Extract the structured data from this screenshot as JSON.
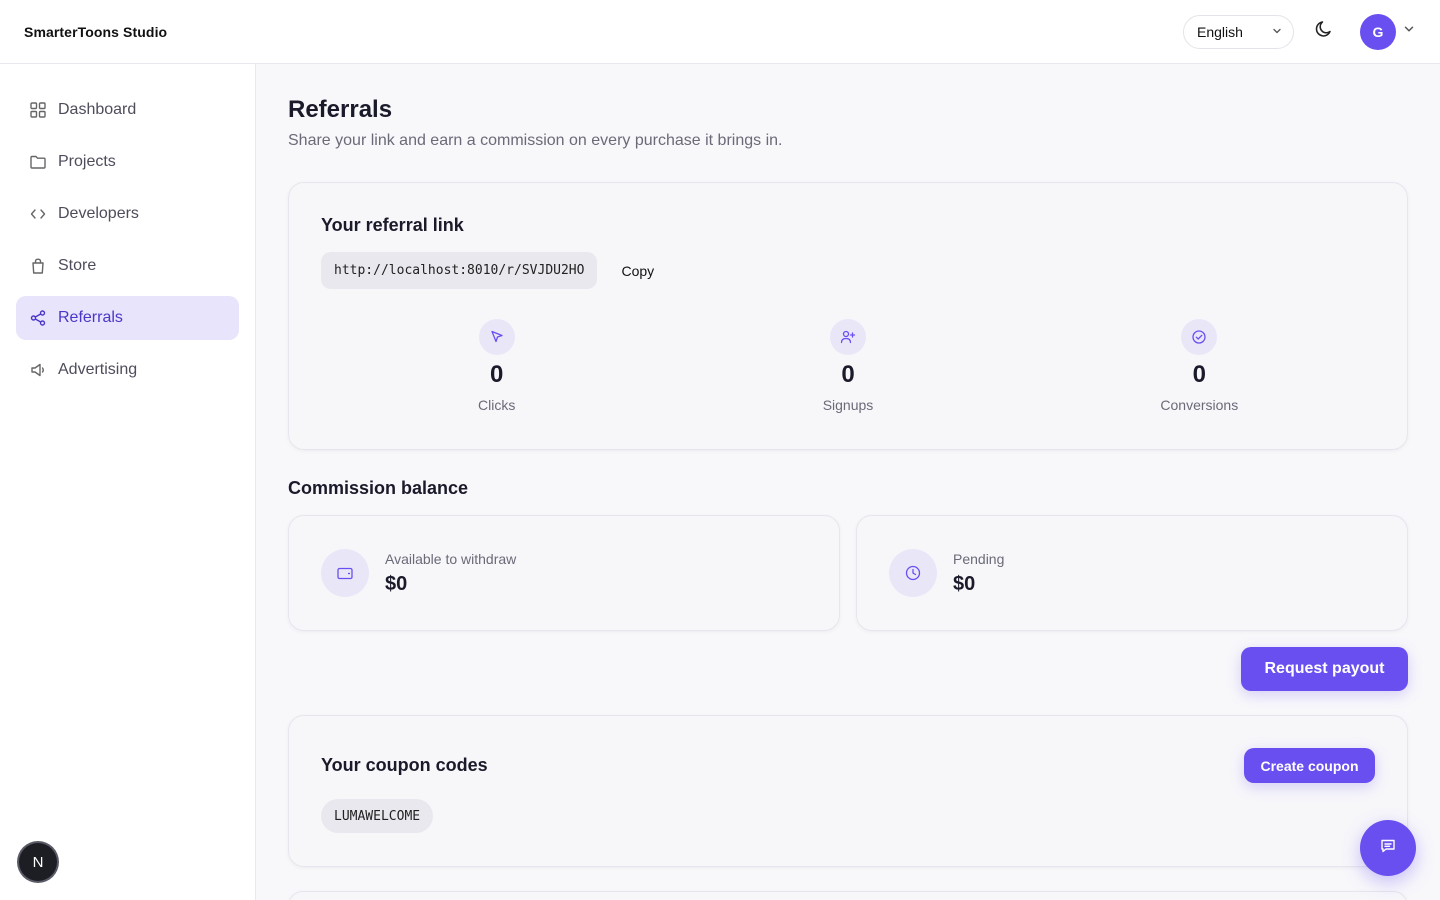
{
  "app": {
    "brand": "SmarterToons Studio"
  },
  "header": {
    "language": "English",
    "theme_icon": "moon-icon",
    "user_initial": "G"
  },
  "sidebar": {
    "items": [
      {
        "label": "Dashboard",
        "icon": "grid-icon",
        "active": false
      },
      {
        "label": "Projects",
        "icon": "folder-icon",
        "active": false
      },
      {
        "label": "Developers",
        "icon": "code-icon",
        "active": false
      },
      {
        "label": "Store",
        "icon": "shopping-bag-icon",
        "active": false
      },
      {
        "label": "Referrals",
        "icon": "share-icon",
        "active": true
      },
      {
        "label": "Advertising",
        "icon": "megaphone-icon",
        "active": false
      }
    ],
    "badge": "N"
  },
  "page": {
    "title": "Referrals",
    "subtitle": "Share your link and earn a commission on every purchase it brings in."
  },
  "referral": {
    "title": "Your referral link",
    "link": "http://localhost:8010/r/SVJDU2HO",
    "copy_label": "Copy",
    "stats": [
      {
        "value": "0",
        "label": "Clicks",
        "icon": "cursor-icon"
      },
      {
        "value": "0",
        "label": "Signups",
        "icon": "user-plus-icon"
      },
      {
        "value": "0",
        "label": "Conversions",
        "icon": "check-circle-icon"
      }
    ]
  },
  "commission": {
    "title": "Commission balance",
    "available_label": "Available to withdraw",
    "available_value": "$0",
    "pending_label": "Pending",
    "pending_value": "$0",
    "payout_label": "Request payout"
  },
  "coupons": {
    "title": "Your coupon codes",
    "create_label": "Create coupon",
    "codes": [
      "LUMAWELCOME"
    ]
  },
  "colors": {
    "accent": "#6a4ff0",
    "active_nav_bg": "#e7e4fb",
    "active_nav_text": "#4a36c9"
  }
}
